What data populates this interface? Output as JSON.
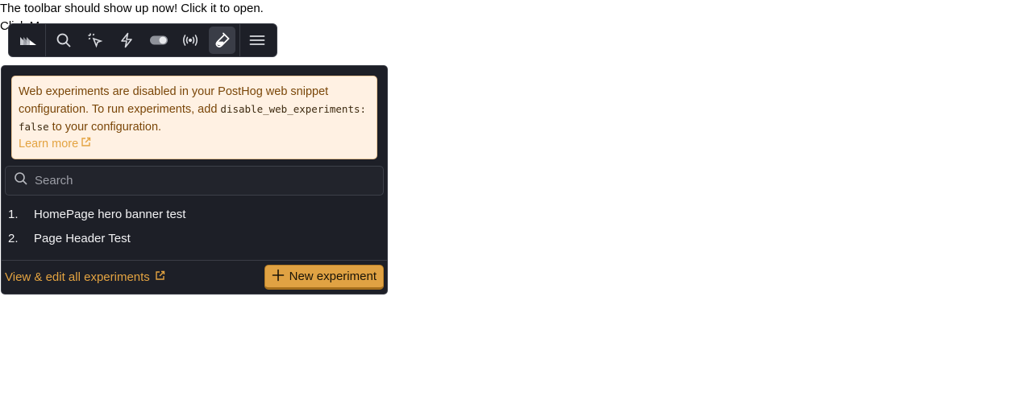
{
  "page": {
    "intro_text": "The toolbar should show up now! Click it to open.",
    "click_text": "Click Me"
  },
  "toolbar": {
    "buttons": [
      {
        "name": "posthog-logo-icon",
        "active": false
      },
      {
        "name": "search-icon",
        "active": false
      },
      {
        "name": "inspect-pointer-icon",
        "active": false
      },
      {
        "name": "actions-lightning-icon",
        "active": false
      },
      {
        "name": "feature-flag-toggle-icon",
        "active": false
      },
      {
        "name": "broadcast-icon",
        "active": false
      },
      {
        "name": "experiments-flask-icon",
        "active": true
      },
      {
        "name": "menu-icon",
        "active": false
      }
    ]
  },
  "warning": {
    "text_before": "Web experiments are disabled in your PostHog web snippet configuration. To run experiments, add",
    "code": "disable_web_experiments: false",
    "text_after": "to your configuration.",
    "learn_more": "Learn more"
  },
  "search": {
    "placeholder": "Search",
    "value": ""
  },
  "experiments": [
    {
      "number": "1.",
      "name": "HomePage hero banner test"
    },
    {
      "number": "2.",
      "name": "Page Header Test"
    }
  ],
  "footer": {
    "view_all": "View & edit all experiments",
    "new_experiment": "New experiment"
  },
  "colors": {
    "toolbar_bg": "#1d1f27",
    "accent": "#e0a243",
    "warning_bg": "#fff1e3",
    "warning_text": "#7a4608"
  }
}
